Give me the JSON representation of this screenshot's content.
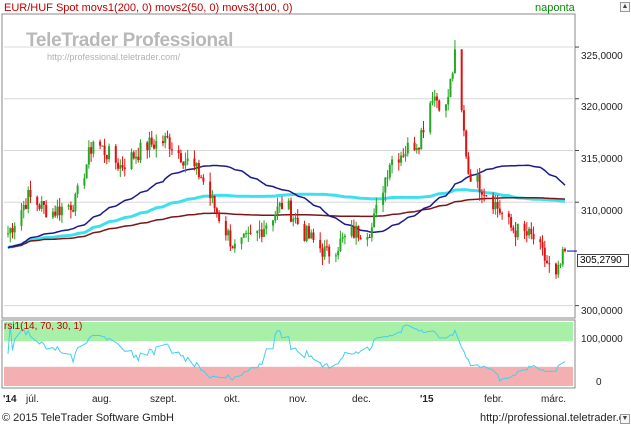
{
  "header": {
    "instrument_line": "EUR/HUF Spot movs1(200, 0) movs2(50, 0) movs3(100, 0)",
    "period": "naponta"
  },
  "watermark": {
    "title": "TeleTrader Professional",
    "url": "http://professional.teletrader.com/"
  },
  "price_axis": {
    "ticks": [
      "325,0000",
      "320,0000",
      "315,0000",
      "310,0000",
      "300,0000"
    ],
    "last_price": "305,2790"
  },
  "rsi_panel": {
    "title": "rsi1(14, 70, 30, 1)",
    "ticks": [
      "100,0000",
      "0"
    ]
  },
  "time_axis": {
    "labels": [
      "'14",
      "júl.",
      "aug.",
      "szept.",
      "okt.",
      "nov.",
      "dec.",
      "'15",
      "febr.",
      "márc."
    ]
  },
  "footer": {
    "copyright": "© 2015 TeleTrader Software GmbH",
    "website": "http://professional.teletrader.com/"
  },
  "colors": {
    "candle_up": "#22a822",
    "candle_down": "#e01010",
    "movs1": "#7a1616",
    "movs2": "#1a1a8a",
    "movs3": "#3ee0f0",
    "rsi_line": "#40d0f0",
    "rsi_overbought_band": "#a8f0a8",
    "rsi_oversold_band": "#f4b0b0",
    "last_price_marker": "#0000c0"
  },
  "chart_data": [
    {
      "type": "candlestick",
      "instrument": "EUR/HUF Spot",
      "ylim": [
        299000,
        328000
      ],
      "y_ticks": [
        300000,
        310000,
        315000,
        320000,
        325000
      ],
      "x_labels": [
        "júl.",
        "aug.",
        "szept.",
        "okt.",
        "nov.",
        "dec.",
        "febr.",
        "márc."
      ],
      "period": "naponta",
      "last_close": 305279,
      "approx_close_path": [
        {
          "x": "2014-07-01",
          "y": 307000
        },
        {
          "x": "2014-07-10",
          "y": 310500
        },
        {
          "x": "2014-07-20",
          "y": 309000
        },
        {
          "x": "2014-07-31",
          "y": 310000
        },
        {
          "x": "2014-08-08",
          "y": 316000
        },
        {
          "x": "2014-08-20",
          "y": 313500
        },
        {
          "x": "2014-09-01",
          "y": 315500
        },
        {
          "x": "2014-09-10",
          "y": 316000
        },
        {
          "x": "2014-09-25",
          "y": 312500
        },
        {
          "x": "2014-10-01",
          "y": 309500
        },
        {
          "x": "2014-10-10",
          "y": 305500
        },
        {
          "x": "2014-10-20",
          "y": 307000
        },
        {
          "x": "2014-11-01",
          "y": 310000
        },
        {
          "x": "2014-11-10",
          "y": 307000
        },
        {
          "x": "2014-11-20",
          "y": 305000
        },
        {
          "x": "2014-12-01",
          "y": 307000
        },
        {
          "x": "2014-12-10",
          "y": 307500
        },
        {
          "x": "2014-12-18",
          "y": 314000
        },
        {
          "x": "2014-12-31",
          "y": 316000
        },
        {
          "x": "2015-01-06",
          "y": 320500
        },
        {
          "x": "2015-01-12",
          "y": 319000
        },
        {
          "x": "2015-01-16",
          "y": 324000
        },
        {
          "x": "2015-01-22",
          "y": 313000
        },
        {
          "x": "2015-02-01",
          "y": 310500
        },
        {
          "x": "2015-02-10",
          "y": 307500
        },
        {
          "x": "2015-02-20",
          "y": 306500
        },
        {
          "x": "2015-03-02",
          "y": 302500
        },
        {
          "x": "2015-03-06",
          "y": 305279
        }
      ],
      "series": [
        {
          "name": "movs1(200, 0)",
          "type": "line"
        },
        {
          "name": "movs2(50, 0)",
          "type": "line"
        },
        {
          "name": "movs3(100, 0)",
          "type": "line"
        }
      ]
    },
    {
      "type": "line",
      "name": "rsi1(14, 70, 30, 1)",
      "ylim": [
        0,
        100
      ],
      "y_ticks": [
        0,
        100
      ],
      "bands": {
        "overbought": 70,
        "oversold": 30
      }
    }
  ]
}
